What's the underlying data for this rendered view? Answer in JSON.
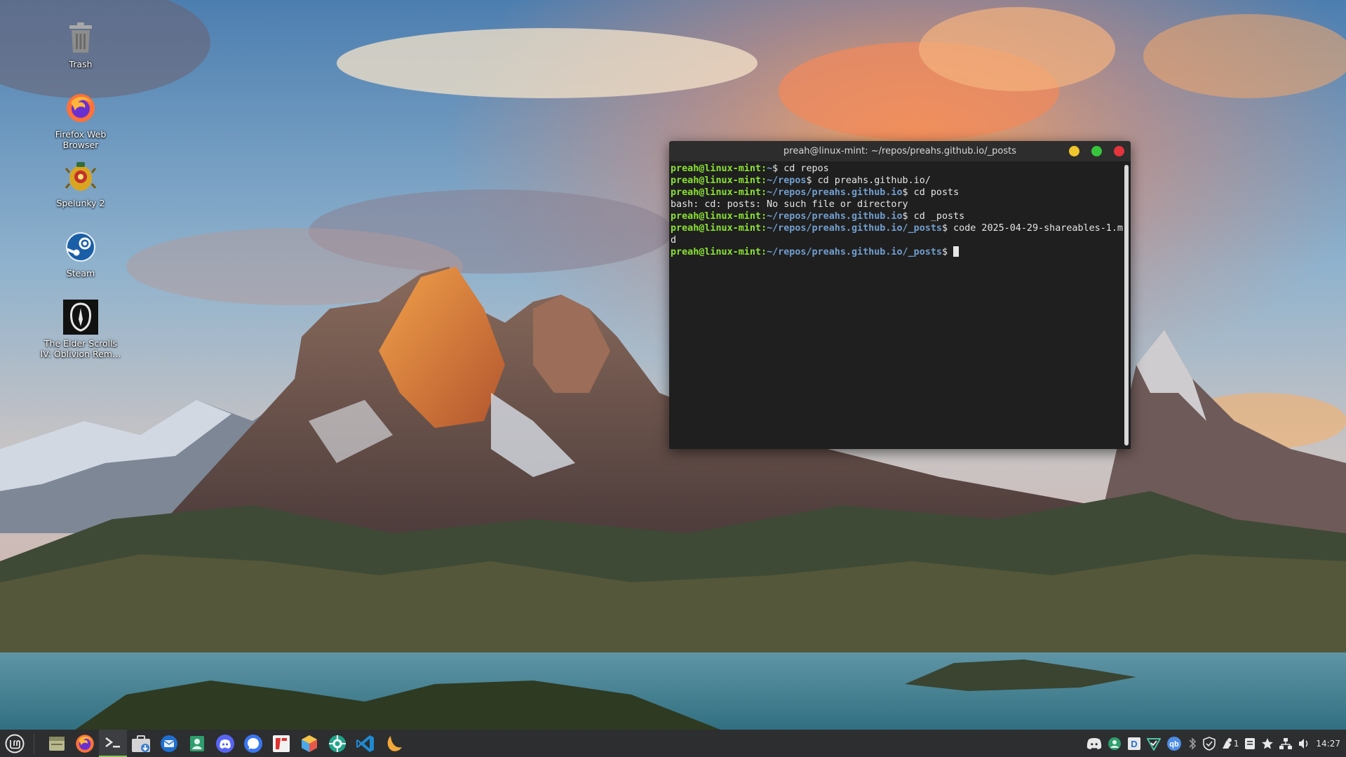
{
  "desktop": {
    "icons": [
      {
        "label": "Trash",
        "icon": "trash-icon"
      },
      {
        "label": "Firefox Web Browser",
        "icon": "firefox-icon"
      },
      {
        "label": "Spelunky 2",
        "icon": "spelunky-icon"
      },
      {
        "label": "Steam",
        "icon": "steam-icon"
      },
      {
        "label": "The Elder Scrolls IV: Oblivion Rem…",
        "icon": "oblivion-icon"
      }
    ]
  },
  "terminal": {
    "title": "preah@linux-mint: ~/repos/preahs.github.io/_posts",
    "lines": [
      {
        "user": "preah@linux-mint",
        "sep": ":",
        "path": "~",
        "cmd": "$ cd repos"
      },
      {
        "user": "preah@linux-mint",
        "sep": ":",
        "path": "~/repos",
        "cmd": "$ cd preahs.github.io/"
      },
      {
        "user": "preah@linux-mint",
        "sep": ":",
        "path": "~/repos/preahs.github.io",
        "cmd": "$ cd posts"
      },
      {
        "text": "bash: cd: posts: No such file or directory"
      },
      {
        "user": "preah@linux-mint",
        "sep": ":",
        "path": "~/repos/preahs.github.io",
        "cmd": "$ cd _posts"
      },
      {
        "user": "preah@linux-mint",
        "sep": ":",
        "path": "~/repos/preahs.github.io/_posts",
        "cmd": "$ code 2025-04-29-shareables-1.m"
      },
      {
        "text": "d"
      },
      {
        "user": "preah@linux-mint",
        "sep": ":",
        "path": "~/repos/preahs.github.io/_posts",
        "cmd": "$ "
      }
    ],
    "colors": {
      "user": "#8ae234",
      "path": "#729fcf",
      "background": "#1f1f1f"
    }
  },
  "taskbar": {
    "launchers": [
      "mint-menu-icon",
      "show-desktop-icon",
      "firefox-icon",
      "terminal-icon",
      "files-icon",
      "thunderbird-icon",
      "timeshift-icon",
      "discord-icon",
      "signal-icon",
      "flathub-icon",
      "software-manager-icon",
      "web-icon",
      "vscode-icon",
      "redshift-icon"
    ],
    "tray": {
      "icons": [
        "discord-tray-icon",
        "timeshift-tray-icon",
        "dropbox-tray-icon",
        "vpn-tray-icon",
        "qbittorrent-tray-icon",
        "bluetooth-tray-icon",
        "shield-tray-icon",
        "update-tray-icon",
        "notes-tray-icon",
        "star-tray-icon",
        "network-tray-icon",
        "volume-tray-icon"
      ],
      "update_count": "1",
      "clock": "14:27"
    }
  }
}
